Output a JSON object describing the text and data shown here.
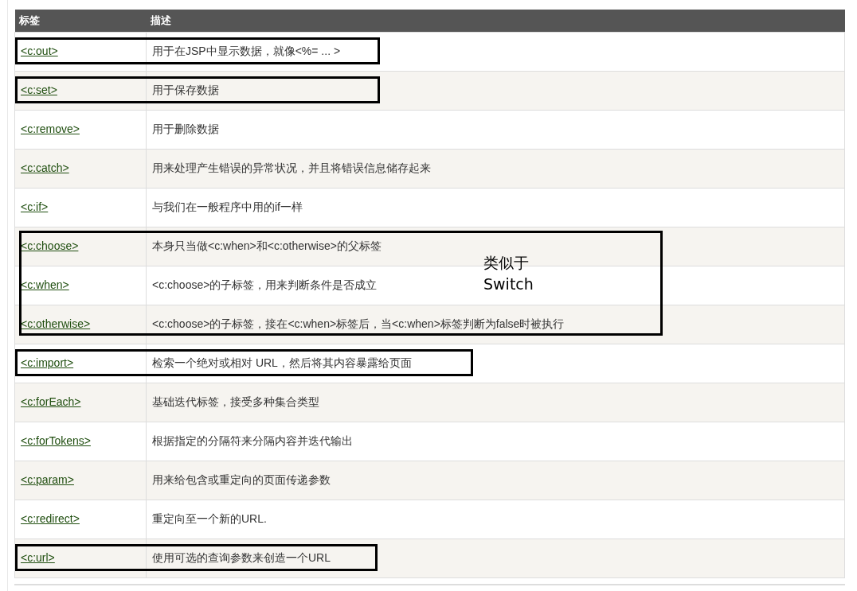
{
  "table": {
    "columns": [
      "标签",
      "描述"
    ],
    "groups": [
      {
        "boxed": true,
        "rows": [
          {
            "tag": "<c:out>",
            "description": "用于在JSP中显示数据，就像<%= ... >"
          }
        ]
      },
      {
        "boxed": true,
        "rows": [
          {
            "tag": "<c:set>",
            "description": "用于保存数据"
          }
        ]
      },
      {
        "boxed": false,
        "rows": [
          {
            "tag": "<c:remove>",
            "description": "用于删除数据"
          },
          {
            "tag": "<c:catch>",
            "description": "用来处理产生错误的异常状况，并且将错误信息储存起来"
          },
          {
            "tag": "<c:if>",
            "description": "与我们在一般程序中用的if一样"
          }
        ]
      },
      {
        "boxed": true,
        "note": "类似于\nSwitch",
        "rows": [
          {
            "tag": "<c:choose>",
            "description": "本身只当做<c:when>和<c:otherwise>的父标签"
          },
          {
            "tag": "<c:when>",
            "description": "<c:choose>的子标签，用来判断条件是否成立"
          },
          {
            "tag": "<c:otherwise>",
            "description": "<c:choose>的子标签，接在<c:when>标签后，当<c:when>标签判断为false时被执行"
          }
        ]
      },
      {
        "boxed": true,
        "rows": [
          {
            "tag": "<c:import>",
            "description": "检索一个绝对或相对 URL，然后将其内容暴露给页面"
          }
        ]
      },
      {
        "boxed": false,
        "rows": [
          {
            "tag": "<c:forEach>",
            "description": "基础迭代标签，接受多种集合类型"
          },
          {
            "tag": "<c:forTokens>",
            "description": "根据指定的分隔符来分隔内容并迭代输出"
          },
          {
            "tag": "<c:param>",
            "description": "用来给包含或重定向的页面传递参数"
          },
          {
            "tag": "<c:redirect>",
            "description": "重定向至一个新的URL."
          }
        ]
      },
      {
        "boxed": true,
        "rows": [
          {
            "tag": "<c:url>",
            "description": "使用可选的查询参数来创造一个URL"
          }
        ]
      }
    ]
  }
}
